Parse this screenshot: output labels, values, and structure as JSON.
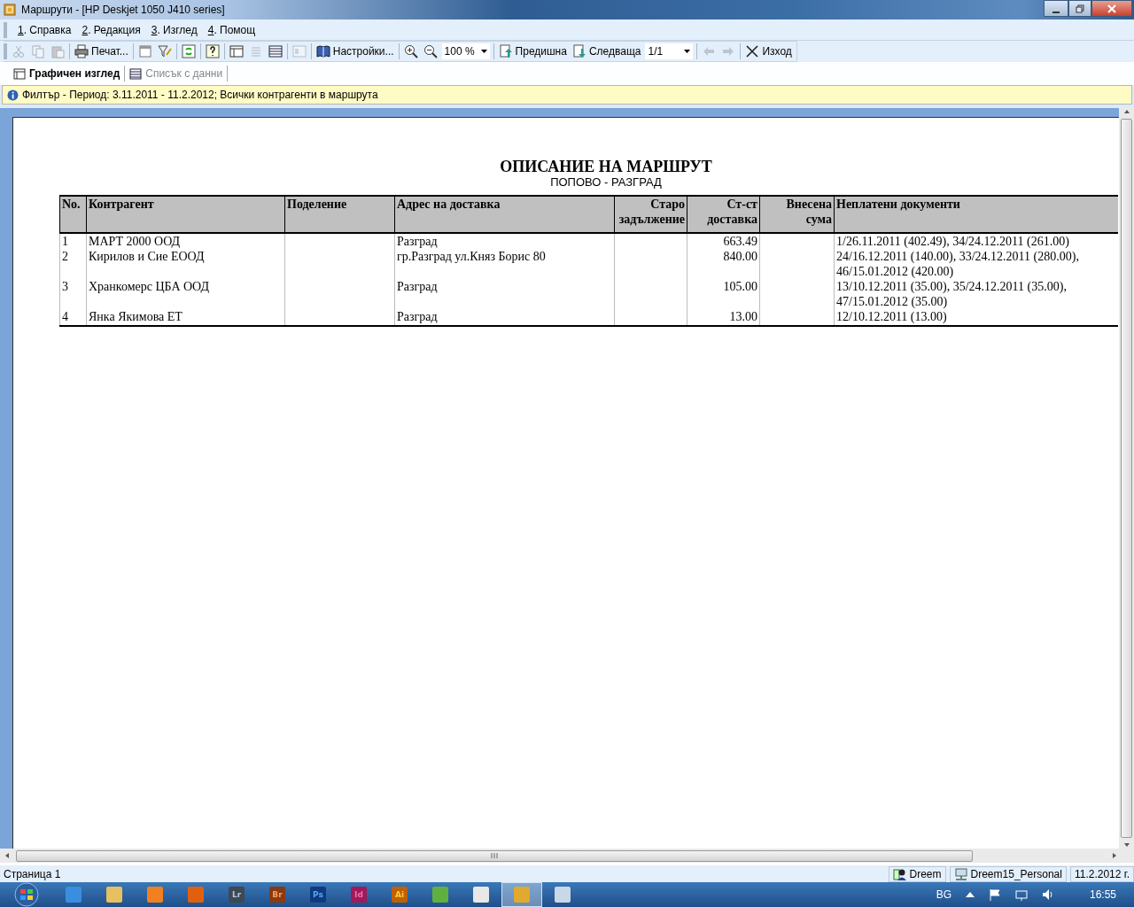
{
  "window": {
    "title": "Маршрути - [HP Deskjet 1050 J410 series]"
  },
  "menu": [
    "1. Справка",
    "2. Редакция",
    "3. Изглед",
    "4. Помощ"
  ],
  "toolbar": [
    {
      "kind": "icon",
      "disabled": true
    },
    {
      "kind": "icon",
      "disabled": true
    },
    {
      "kind": "icon",
      "disabled": true
    },
    {
      "kind": "separator"
    },
    {
      "kind": "button",
      "label": "Печат...",
      "disabled": false
    },
    {
      "kind": "separator"
    },
    {
      "kind": "icon",
      "disabled": false
    },
    {
      "kind": "icon",
      "disabled": false
    },
    {
      "kind": "separator"
    },
    {
      "kind": "icon",
      "disabled": false
    },
    {
      "kind": "separator"
    },
    {
      "kind": "icon",
      "disabled": false
    },
    {
      "kind": "separator"
    },
    {
      "kind": "icon",
      "disabled": false
    },
    {
      "kind": "icon",
      "disabled": true
    },
    {
      "kind": "icon",
      "disabled": false
    },
    {
      "kind": "separator"
    },
    {
      "kind": "icon",
      "disabled": true
    },
    {
      "kind": "separator"
    },
    {
      "kind": "button",
      "label": "Настройки...",
      "disabled": false
    },
    {
      "kind": "separator"
    },
    {
      "kind": "icon",
      "disabled": false
    },
    {
      "kind": "icon",
      "disabled": false
    },
    {
      "kind": "combo",
      "value": "100 %"
    },
    {
      "kind": "separator"
    },
    {
      "kind": "button",
      "label": "Предишна",
      "disabled": false
    },
    {
      "kind": "button",
      "label": "Следваща",
      "disabled": false
    },
    {
      "kind": "combo",
      "value": "1/1"
    },
    {
      "kind": "separator"
    },
    {
      "kind": "icon",
      "disabled": true
    },
    {
      "kind": "icon",
      "disabled": true
    },
    {
      "kind": "separator"
    },
    {
      "kind": "button",
      "label": "Изход",
      "disabled": false
    }
  ],
  "tabs": [
    {
      "label": "Графичен изглед",
      "selected": true
    },
    {
      "label": "Списък с данни",
      "selected": false
    }
  ],
  "filter": "Филтър - Период: 3.11.2011 - 11.2.2012; Всички контрагенти в маршрута",
  "report": {
    "title": "ОПИСАНИЕ НА МАРШРУТ",
    "subtitle": "ПОПОВО - РАЗГРАД",
    "columns": [
      {
        "label": "No.",
        "kind": "text"
      },
      {
        "label": "Контрагент",
        "kind": "text"
      },
      {
        "label": "Поделение",
        "kind": "text"
      },
      {
        "label": "Адрес на доставка",
        "kind": "text"
      },
      {
        "label": "Старо задължение",
        "kind": "number"
      },
      {
        "label": "Ст-ст доставка",
        "kind": "number"
      },
      {
        "label": "Внесена сума",
        "kind": "number"
      },
      {
        "label": "Неплатени документи",
        "kind": "text"
      }
    ],
    "rows": [
      [
        "1",
        "МАРТ 2000 ООД",
        "",
        "Разград",
        "",
        "663.49",
        "",
        "1/26.11.2011 (402.49), 34/24.12.2011 (261.00)"
      ],
      [
        "2",
        "Кирилов и Сие ЕООД",
        "",
        "гр.Разград ул.Княз Борис 80",
        "",
        "840.00",
        "",
        "24/16.12.2011 (140.00), 33/24.12.2011 (280.00), 46/15.01.2012 (420.00)"
      ],
      [
        "3",
        "Хранкомерс ЦБА ООД",
        "",
        "Разград",
        "",
        "105.00",
        "",
        "13/10.12.2011 (35.00), 35/24.12.2011 (35.00), 47/15.01.2012 (35.00)"
      ],
      [
        "4",
        "Янка Якимова ЕТ",
        "",
        "Разград",
        "",
        "13.00",
        "",
        "12/10.12.2011 (13.00)"
      ]
    ]
  },
  "status_bar": {
    "page": "Страница 1",
    "panels": [
      "Dreem",
      "Dreem15_Personal",
      "11.2.2012 г."
    ]
  },
  "taskbar": {
    "apps": [
      {
        "selected": false
      },
      {
        "selected": false
      },
      {
        "selected": false
      },
      {
        "selected": false
      },
      {
        "label": "Lr",
        "selected": false
      },
      {
        "label": "Br",
        "selected": false
      },
      {
        "label": "Ps",
        "selected": false
      },
      {
        "label": "Id",
        "selected": false
      },
      {
        "label": "Ai",
        "selected": false
      },
      {
        "selected": false
      },
      {
        "selected": false
      },
      {
        "selected": true
      },
      {
        "selected": false
      }
    ],
    "language": "BG",
    "time": "16:55"
  }
}
